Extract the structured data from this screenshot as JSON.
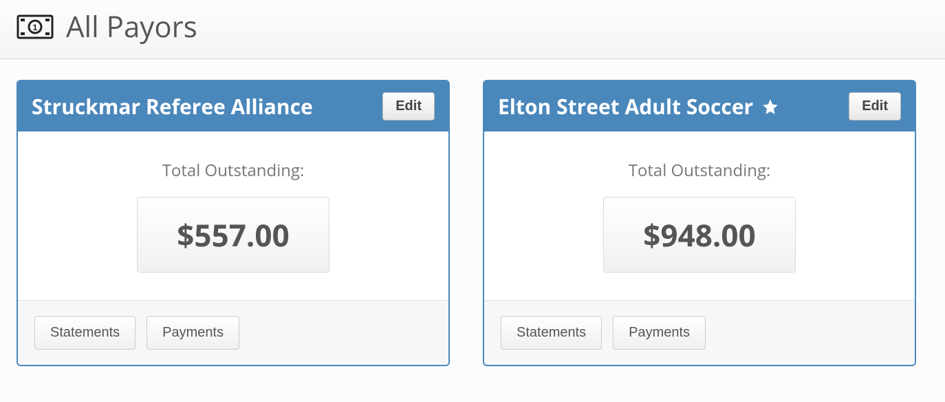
{
  "header": {
    "title": "All Payors"
  },
  "buttons": {
    "edit": "Edit",
    "statements": "Statements",
    "payments": "Payments"
  },
  "labels": {
    "total_outstanding": "Total Outstanding:"
  },
  "payors": [
    {
      "name": "Struckmar Referee Alliance",
      "starred": false,
      "amount": "$557.00"
    },
    {
      "name": "Elton Street Adult Soccer",
      "starred": true,
      "amount": "$948.00"
    }
  ]
}
